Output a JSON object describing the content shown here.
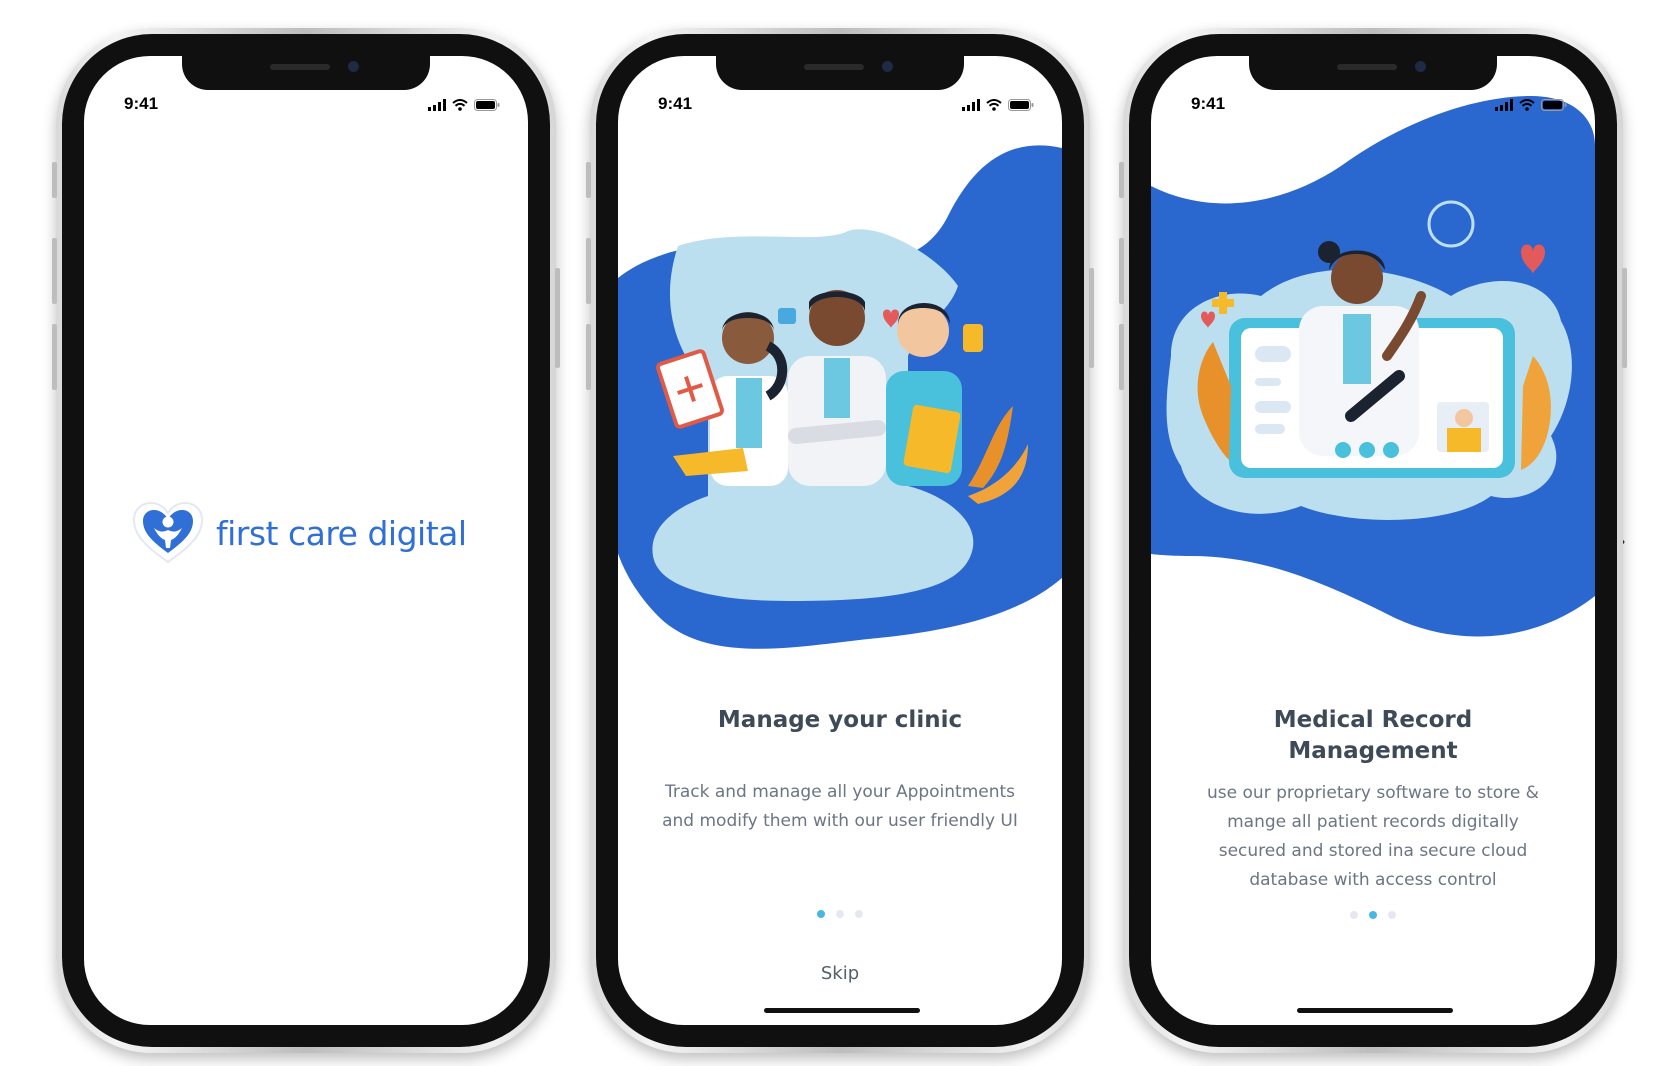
{
  "colors": {
    "brand_blue": "#2a67cf",
    "light_blue": "#bcdff0",
    "dot_active": "#49b6e8",
    "dot_inactive": "#e6e8f0",
    "title_text": "#3f4a58",
    "body_text": "#6b7583"
  },
  "status_bar": {
    "time": "9:41",
    "icons": [
      "cellular-signal-icon",
      "wifi-icon",
      "battery-icon"
    ]
  },
  "screens": [
    {
      "id": "splash",
      "logo_text": "first care digital",
      "logo_icon": "heart-person-logo-icon"
    },
    {
      "id": "onboarding-1",
      "title": "Manage your clinic",
      "body": [
        "Track and manage all your Appointments",
        "and modify them with our user friendly UI"
      ],
      "illustration": "three-medical-staff-illustration",
      "page_indicator": {
        "count": 3,
        "active": 1
      },
      "skip_label": "Skip"
    },
    {
      "id": "onboarding-2",
      "title": [
        "Medical Record",
        "Management"
      ],
      "body": [
        "use our proprietary software to store &",
        "mange all patient records digitally",
        "secured and stored ina secure cloud",
        "database with access control"
      ],
      "illustration": "telemedicine-doctor-video-call-illustration",
      "page_indicator": {
        "count": 3,
        "active": 2
      }
    }
  ],
  "navigation": {
    "prev_icon": "chevron-left-icon",
    "next_icon": "chevron-right-icon"
  }
}
